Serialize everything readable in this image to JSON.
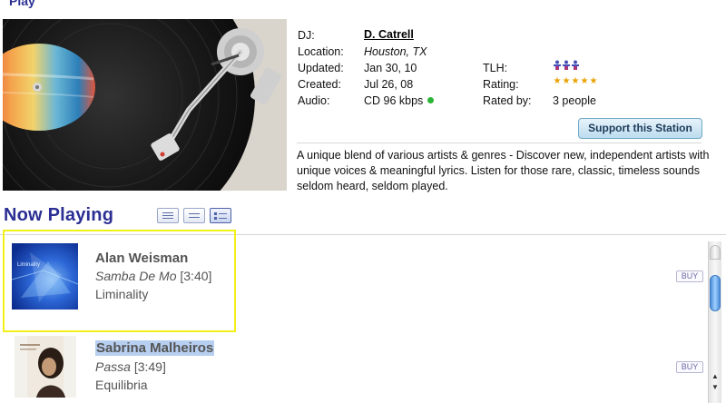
{
  "header": {
    "top_link": "Play"
  },
  "station": {
    "fields": {
      "dj_label": "DJ:",
      "dj_value": "D. Catrell",
      "location_label": "Location:",
      "location_value": "Houston, TX",
      "updated_label": "Updated:",
      "updated_value": "Jan 30, 10",
      "created_label": "Created:",
      "created_value": "Jul 26, 08",
      "audio_label": "Audio:",
      "audio_value": "CD 96 kbps",
      "tlh_label": "TLH:",
      "rating_label": "Rating:",
      "rated_by_label": "Rated by:",
      "rated_by_value": "3 people"
    },
    "rating": {
      "stars": 5,
      "max": 5
    },
    "support_button": "Support this Station",
    "description": "A unique blend of various artists & genres - Discover new, independent artists with unique voices & meaningful lyrics. Listen for those rare, classic, timeless sounds seldom heard, seldom played.",
    "colors": {
      "link_blue": "#2b2f93",
      "audio_status": "#2bb536",
      "star": "#e8a100"
    }
  },
  "now_playing": {
    "title": "Now Playing",
    "tracks": [
      {
        "artist": "Alan Weisman",
        "song": "Samba De Mo",
        "duration": "[3:40]",
        "album": "Liminality",
        "buy": "BUY",
        "cover_text": "Liminality"
      },
      {
        "artist": "Sabrina Malheiros",
        "song": "Passa",
        "duration": "[3:49]",
        "album": "Equilibria",
        "buy": "BUY",
        "cover_text": ""
      }
    ]
  }
}
